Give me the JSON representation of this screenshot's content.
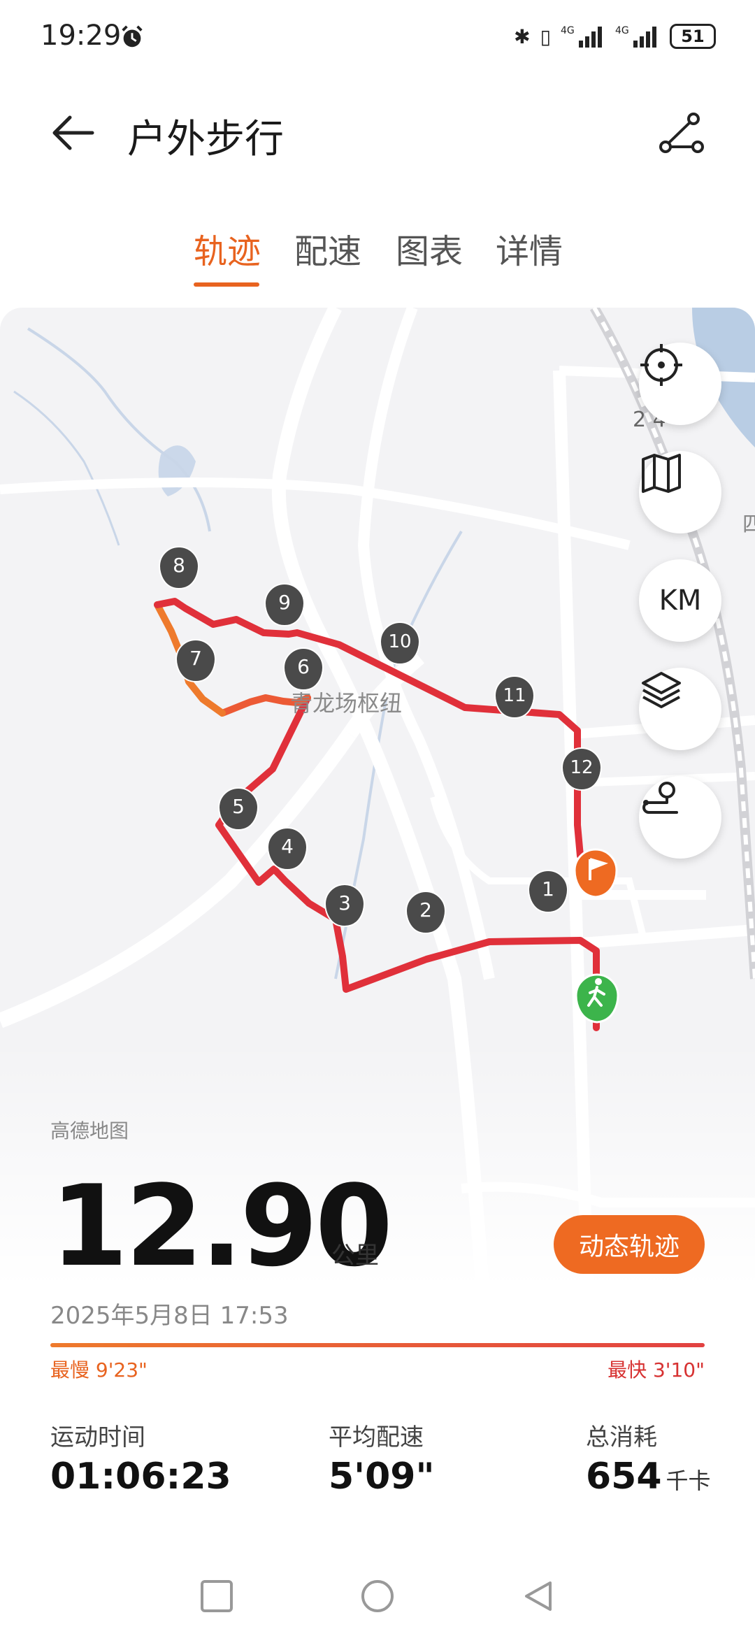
{
  "status_bar": {
    "time": "19:29",
    "battery": "51",
    "network1": "4G",
    "network2": "4G"
  },
  "header": {
    "title": "户外步行"
  },
  "tabs": [
    {
      "label": "轨迹",
      "active": true
    },
    {
      "label": "配速",
      "active": false
    },
    {
      "label": "图表",
      "active": false
    },
    {
      "label": "详情",
      "active": false
    }
  ],
  "map": {
    "place_label": "青龙场枢纽",
    "road_number_label": "2 4",
    "edge_label": "四",
    "km_button_label": "KM",
    "markers": [
      "1",
      "2",
      "3",
      "4",
      "5",
      "6",
      "7",
      "8",
      "9",
      "10",
      "11",
      "12"
    ],
    "attribution": "高德地图"
  },
  "summary": {
    "distance": "12.90",
    "distance_unit": "公里",
    "replay_button": "动态轨迹",
    "datetime": "2025年5月8日 17:53",
    "slowest_label": "最慢 9'23\"",
    "fastest_label": "最快 3'10\""
  },
  "stats": [
    {
      "label": "运动时间",
      "value": "01:06:23",
      "unit": ""
    },
    {
      "label": "平均配速",
      "value": "5'09\"",
      "unit": ""
    },
    {
      "label": "总消耗",
      "value": "654",
      "unit": "千卡"
    }
  ],
  "colors": {
    "accent": "#e8631f",
    "route": "#e0303a",
    "start": "#3cb44b"
  }
}
